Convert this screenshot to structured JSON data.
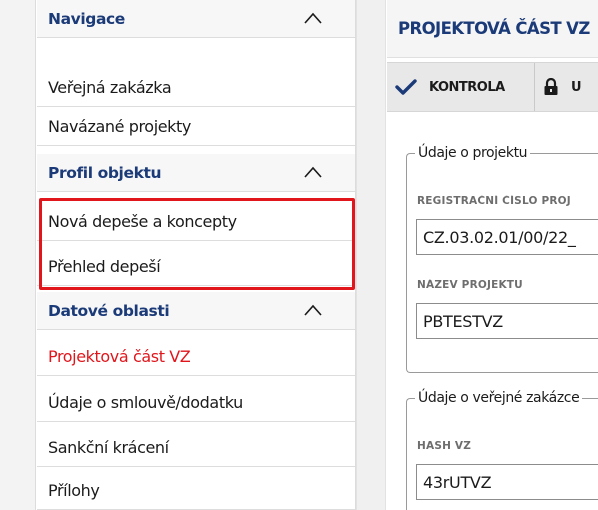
{
  "sidebar": {
    "items": [
      {
        "label": "Navigace",
        "type": "header"
      },
      {
        "label": "Veřejná zakázka",
        "type": "item"
      },
      {
        "label": "Navázané projekty",
        "type": "item"
      },
      {
        "label": "Profil objektu",
        "type": "header"
      },
      {
        "label": "Nová depeše a koncepty",
        "type": "item"
      },
      {
        "label": "Přehled depeší",
        "type": "item"
      },
      {
        "label": "Datové oblasti",
        "type": "header"
      },
      {
        "label": "Projektová část VZ",
        "type": "item",
        "active": true
      },
      {
        "label": "Údaje o smlouvě/dodatku",
        "type": "item"
      },
      {
        "label": "Sankční krácení",
        "type": "item"
      },
      {
        "label": "Přílohy",
        "type": "item"
      }
    ]
  },
  "panel": {
    "title": "PROJEKTOVÁ ČÁST VZ",
    "toolbar": {
      "kontrola_label": "KONTROLA",
      "second_label": "U"
    },
    "project_group": {
      "legend": "Údaje o projektu",
      "reg_label": "REGISTRAČNÍ ČÍSLO PROJ",
      "reg_value": "CZ.03.02.01/00/22_",
      "name_label": "NÁZEV PROJEKTU",
      "name_value": "PBTESTVZ"
    },
    "contract_group": {
      "legend": "Údaje o veřejné zakázce",
      "hash_label": "HASH VZ",
      "hash_value": "43rUTVZ"
    }
  },
  "colors": {
    "header_text": "#1b3a78",
    "active_text": "#e0161c",
    "highlight_border": "#e0161c"
  }
}
